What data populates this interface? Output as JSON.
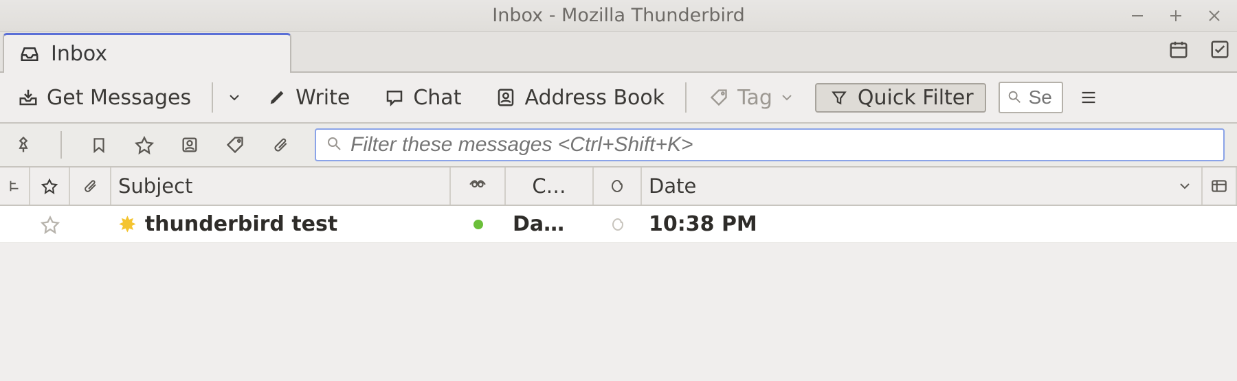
{
  "window": {
    "title": "Inbox - Mozilla Thunderbird"
  },
  "tab": {
    "label": "Inbox"
  },
  "toolbar": {
    "get_messages": "Get Messages",
    "write": "Write",
    "chat": "Chat",
    "address_book": "Address Book",
    "tag": "Tag",
    "quick_filter": "Quick Filter",
    "search_placeholder": "Se"
  },
  "filter": {
    "placeholder": "Filter these messages <Ctrl+Shift+K>"
  },
  "columns": {
    "subject": "Subject",
    "correspondents": "C…",
    "date": "Date"
  },
  "messages": [
    {
      "subject": "thunderbird test",
      "correspondent": "Da…",
      "date": "10:38 PM",
      "unread": true,
      "new": true
    }
  ]
}
